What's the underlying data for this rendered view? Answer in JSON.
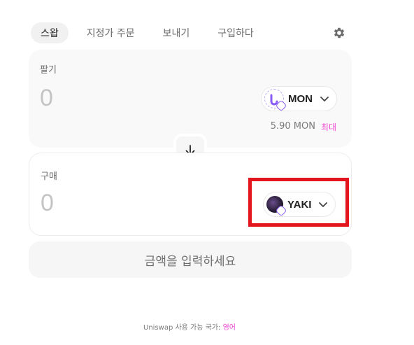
{
  "tabs": [
    {
      "label": "스왑",
      "active": true
    },
    {
      "label": "지정가 주문",
      "active": false
    },
    {
      "label": "보내기",
      "active": false
    },
    {
      "label": "구입하다",
      "active": false
    }
  ],
  "settings_icon": "gear-icon",
  "sell": {
    "label": "팔기",
    "amount": "0",
    "token": {
      "ticker": "MON",
      "icon": "monad-token-icon"
    },
    "balance": "5.90 MON",
    "max_label": "최대"
  },
  "switch_icon": "arrow-down-icon",
  "buy": {
    "label": "구매",
    "amount": "0",
    "token": {
      "ticker": "YAKI",
      "icon": "yaki-token-icon"
    }
  },
  "action_button": "금액을 입력하세요",
  "footer": {
    "text": "Uniswap 사용 가능 국가: ",
    "language": "영어"
  },
  "colors": {
    "accent_pink": "#f049d4",
    "highlight_red": "#e3161e",
    "monad_purple": "#8a5cf6"
  }
}
